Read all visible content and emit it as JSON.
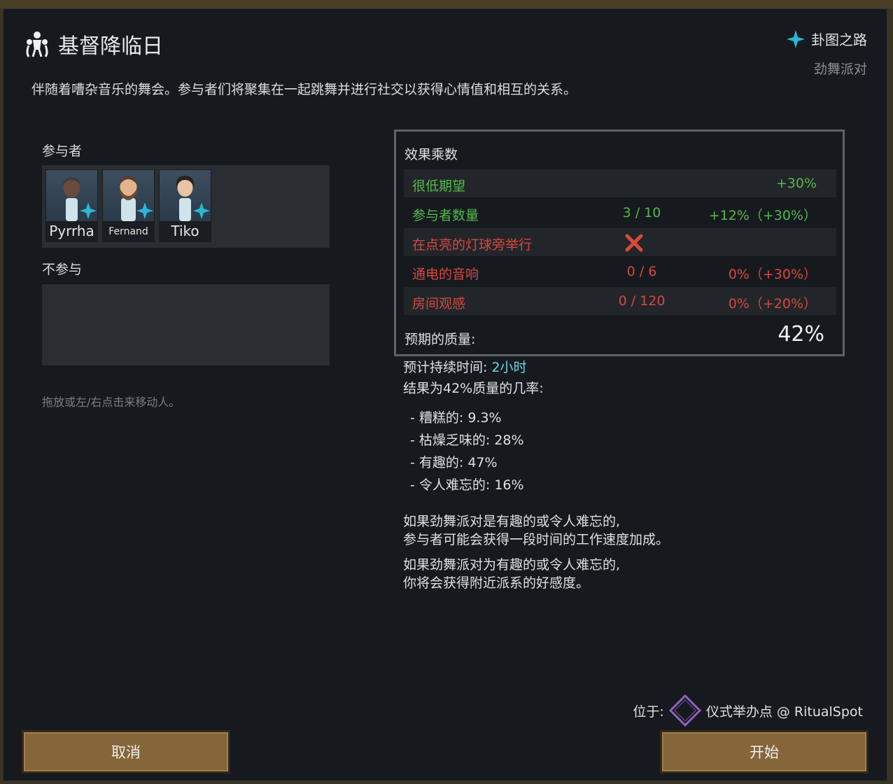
{
  "dialog": {
    "title": "基督降临日",
    "title_icon": "ritual-figure-icon",
    "description": "伴随着嘈杂音乐的舞会。参与者们将聚集在一起跳舞并进行社交以获得心情值和相互的关系。"
  },
  "ideoligion": {
    "name": "卦图之路",
    "icon": "ideo-star-icon",
    "icon_color": "#2bb7d6",
    "ritual_type": "劲舞派对"
  },
  "participants": {
    "label": "参与者",
    "pawns": [
      {
        "name": "Pyrrha"
      },
      {
        "name": "Fernand"
      },
      {
        "name": "Tiko"
      }
    ]
  },
  "non_participants": {
    "label": "不参与"
  },
  "hint": "拖放或左/右点击来移动人。",
  "effects": {
    "title": "效果乘数",
    "rows": [
      {
        "name": "很低期望",
        "progress": "",
        "value": "+30%",
        "status": "good"
      },
      {
        "name": "参与者数量",
        "progress": "3 / 10",
        "value": "+12%（+30%）",
        "status": "good"
      },
      {
        "name": "在点亮的灯球旁举行",
        "progress": "",
        "value": "",
        "status": "bad",
        "mark": "cross-icon"
      },
      {
        "name": "通电的音响",
        "progress": "0 / 6",
        "value": "0%（+30%）",
        "status": "bad"
      },
      {
        "name": "房间观感",
        "progress": "0 / 120",
        "value": "0%（+20%）",
        "status": "bad"
      }
    ],
    "quality_label": "预期的质量:",
    "quality_value": "42%",
    "colors": {
      "good": "#55b84a",
      "bad": "#d8473f"
    }
  },
  "duration": {
    "label": "预计持续时间:",
    "value": "2小时"
  },
  "odds": {
    "label": "结果为42%质量的几率:",
    "items": [
      "- 糟糕的: 9.3%",
      "- 枯燥乏味的: 28%",
      "- 有趣的: 47%",
      "- 令人难忘的: 16%"
    ]
  },
  "notes": {
    "note1_line1": "如果劲舞派对是有趣的或令人难忘的,",
    "note1_line2": "参与者可能会获得一段时间的工作速度加成。",
    "note2_line1": "如果劲舞派对为有趣的或令人难忘的,",
    "note2_line2": "你将会获得附近派系的好感度。"
  },
  "location": {
    "label": "位于:",
    "icon": "ritual-spot-diamond-icon",
    "icon_color": "#8e63b8",
    "value": "仪式举办点 @ RitualSpot"
  },
  "buttons": {
    "cancel": "取消",
    "start": "开始"
  }
}
